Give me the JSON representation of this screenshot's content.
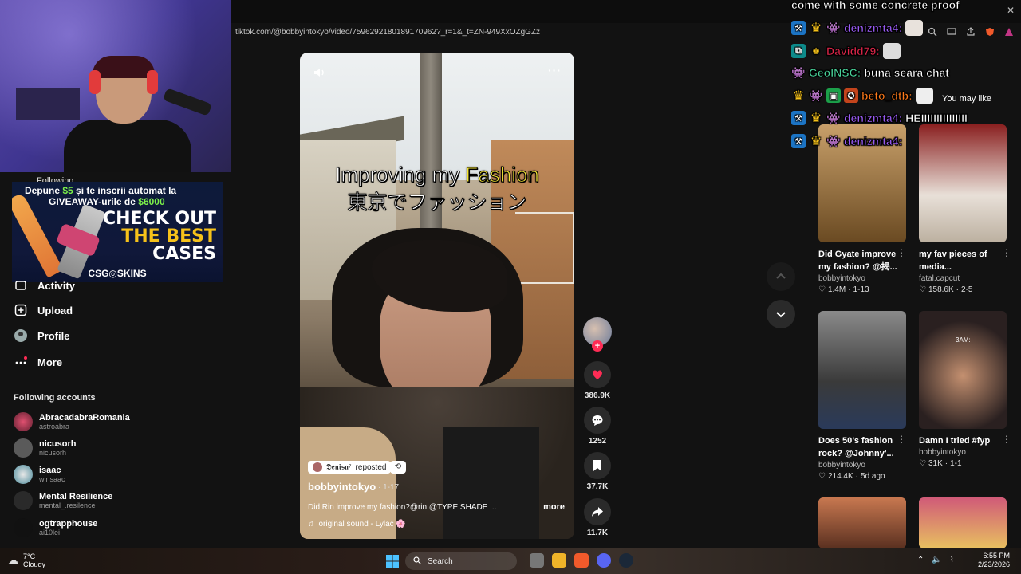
{
  "browser": {
    "url": "tiktok.com/@bobbyintokyo/video/7596292180189170962?_r=1&_t=ZN-949XxOZgGZz",
    "close": "✕"
  },
  "ad": {
    "line1_pre": "Depune ",
    "line1_amount": "$5",
    "line1_post": " și te inscrii automat la",
    "line2_pre": "GIVEAWAY-urile de ",
    "line2_amount": "$6000",
    "big1": "CHECK OUT",
    "big2": "THE BEST",
    "big3": "CASES",
    "brand": "CSG◎SKINS"
  },
  "webcam_overlay_text": "Following",
  "nav": {
    "activity": "Activity",
    "upload": "Upload",
    "profile": "Profile",
    "more": "More"
  },
  "following": {
    "heading": "Following accounts",
    "accounts": [
      {
        "name": "AbracadabraRomania",
        "handle": "astroabra"
      },
      {
        "name": "nicusorh",
        "handle": "nicusorh"
      },
      {
        "name": "isaac",
        "handle": "winsaac"
      },
      {
        "name": "Mental Resilience",
        "handle": "mental_.resilence"
      },
      {
        "name": "ogtrapphouse",
        "handle": "ai10lei"
      }
    ]
  },
  "video": {
    "title_pre": "Improving my ",
    "title_highlight": "Fashion",
    "title_jp": "東京でファッション",
    "more_dots": "···",
    "reposted_by": "𝕯𝖊𝖓𝖎𝖘𝖆⁷",
    "reposted_label": "reposted",
    "author": "bobbyintokyo",
    "date": "· 1-17",
    "description": "Did Rin improve my fashion?@rin @TYPE SHADE ...",
    "more": "more",
    "sound": "original sound - Lylac 🌸"
  },
  "actions": {
    "likes": "386.9K",
    "comments": "1252",
    "saves": "37.7K",
    "shares": "11.7K"
  },
  "right": {
    "header": "You may like",
    "cards": [
      {
        "title": "Did Gyate improve my fashion? @揭...",
        "author": "bobbyintokyo",
        "likes": "1.4M",
        "date": "1-13"
      },
      {
        "title": "my fav pieces of media...",
        "author": "fatal.capcut",
        "likes": "158.6K",
        "date": "2-5"
      },
      {
        "title": "Does 50’s fashion rock? @Johnny'...",
        "author": "bobbyintokyo",
        "likes": "214.4K",
        "date": "5d ago"
      },
      {
        "title": "Damn I tried #fyp",
        "author": "bobbyintokyo",
        "likes": "31K",
        "date": "1-1"
      }
    ],
    "thumb_text": "3AM:"
  },
  "chat": [
    {
      "user": "",
      "message": "come with some concrete proof",
      "color": "#ffffff"
    },
    {
      "user": "denizmta4:",
      "message": "",
      "color": "#9b5cf6"
    },
    {
      "user": "Davidd79:",
      "message": "",
      "color": "#e0264a"
    },
    {
      "user": "GeoINSC:",
      "message": "buna seara chat",
      "color": "#49d39a"
    },
    {
      "user": "beto_dtb:",
      "message": "",
      "color": "#ff7a1a"
    },
    {
      "user": "denizmta4:",
      "message": "HEIIIIIIIIIIIIIII",
      "color": "#9b5cf6"
    },
    {
      "user": "denizmta4:",
      "message": "",
      "color": "#9b5cf6"
    }
  ],
  "taskbar": {
    "temp": "7°C",
    "weather": "Cloudy",
    "search": "Search",
    "time": "6:55 PM",
    "date": "2/23/2026"
  },
  "colors": {
    "accent_red": "#fe2c55",
    "chat_purple": "#9b5cf6",
    "ad_green": "#7cf04a",
    "ad_yellow": "#f6c21a"
  }
}
